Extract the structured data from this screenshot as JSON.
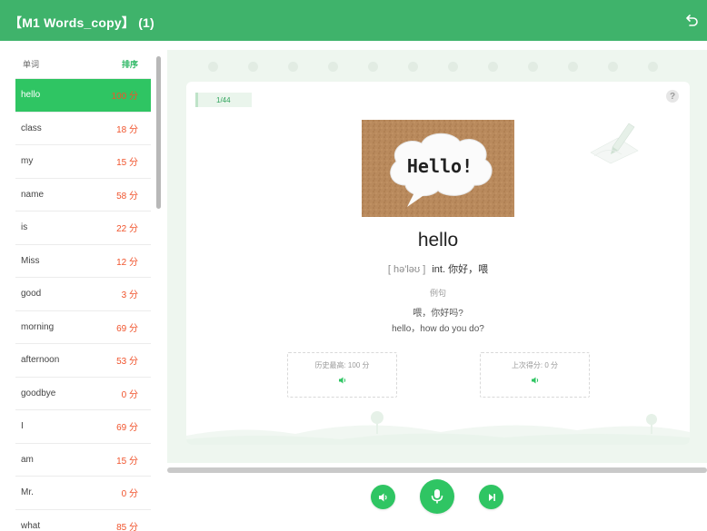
{
  "header": {
    "title": "【M1 Words_copy】 (1)"
  },
  "list": {
    "col_word": "单词",
    "col_sort": "排序",
    "items": [
      {
        "word": "hello",
        "score": "100 分"
      },
      {
        "word": "class",
        "score": "18 分"
      },
      {
        "word": "my",
        "score": "15 分"
      },
      {
        "word": "name",
        "score": "58 分"
      },
      {
        "word": "is",
        "score": "22 分"
      },
      {
        "word": "Miss",
        "score": "12 分"
      },
      {
        "word": "good",
        "score": "3 分"
      },
      {
        "word": "morning",
        "score": "69 分"
      },
      {
        "word": "afternoon",
        "score": "53 分"
      },
      {
        "word": "goodbye",
        "score": "0 分"
      },
      {
        "word": "I",
        "score": "69 分"
      },
      {
        "word": "am",
        "score": "15 分"
      },
      {
        "word": "Mr.",
        "score": "0 分"
      },
      {
        "word": "what",
        "score": "85 分"
      }
    ]
  },
  "card": {
    "progress": "1/44",
    "help": "?",
    "image_text": "Hello!",
    "word": "hello",
    "phonetic": "[ hə'ləʊ ]",
    "definition": "int. 你好，喂",
    "example_label": "例句",
    "example_cn": "喂，你好吗?",
    "example_en": "hello，how do you do?",
    "history_best": "历史最高: 100 分",
    "last_score": "上次得分: 0 分"
  },
  "colors": {
    "header": "#3fb36b",
    "accent": "#2fc563",
    "score": "#f0532c"
  },
  "icons": {
    "back": "undo-arrow-icon",
    "play": "speaker-icon",
    "record": "microphone-icon",
    "next": "skip-next-icon"
  }
}
